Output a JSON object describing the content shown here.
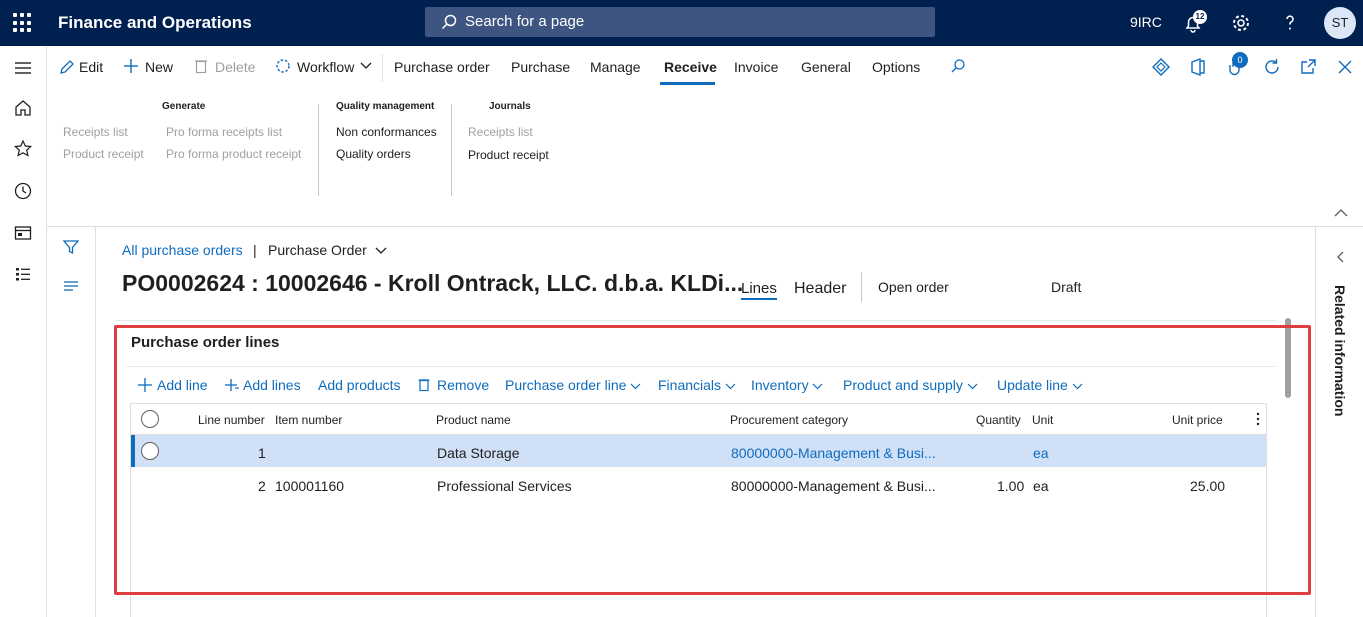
{
  "topbar": {
    "app_title": "Finance and Operations",
    "search_placeholder": "Search for a page",
    "company": "9IRC",
    "notification_count": "12",
    "avatar_initials": "ST"
  },
  "actionpane": {
    "edit": "Edit",
    "new": "New",
    "delete": "Delete",
    "workflow": "Workflow",
    "tabs": [
      "Purchase order",
      "Purchase",
      "Manage",
      "Receive",
      "Invoice",
      "General",
      "Options"
    ],
    "active_tab": "Receive",
    "attachments_count": "0",
    "groups": {
      "generate": {
        "title": "Generate",
        "col1": [
          "Receipts list",
          "Product receipt"
        ],
        "col2": [
          "Pro forma receipts list",
          "Pro forma product receipt"
        ]
      },
      "quality": {
        "title": "Quality management",
        "links": [
          "Non conformances",
          "Quality orders"
        ]
      },
      "journals": {
        "title": "Journals",
        "links": [
          "Receipts list",
          "Product receipt"
        ]
      }
    }
  },
  "page": {
    "breadcrumb_link": "All purchase orders",
    "breadcrumb_sep": "|",
    "breadcrumb_form": "Purchase Order",
    "title": "PO0002624 : 10002646 - Kroll Ontrack, LLC. d.b.a. KLDi...",
    "view_lines": "Lines",
    "view_header": "Header",
    "status_order": "Open order",
    "status_approval": "Draft"
  },
  "lines": {
    "section_title": "Purchase order lines",
    "toolbar": {
      "add_line": "Add line",
      "add_lines": "Add lines",
      "add_products": "Add products",
      "remove": "Remove",
      "purchase_order_line": "Purchase order line",
      "financials": "Financials",
      "inventory": "Inventory",
      "product_and_supply": "Product and supply",
      "update_line": "Update line"
    },
    "columns": [
      "Line number",
      "Item number",
      "Product name",
      "Procurement category",
      "Quantity",
      "Unit",
      "Unit price"
    ],
    "rows": [
      {
        "line_number": "1",
        "item_number": "",
        "product_name": "Data Storage",
        "procurement_category": "80000000-Management & Busi...",
        "quantity": "",
        "unit": "ea",
        "unit_price": ""
      },
      {
        "line_number": "2",
        "item_number": "100001160",
        "product_name": "Professional Services",
        "procurement_category": "80000000-Management & Busi...",
        "quantity": "1.00",
        "unit": "ea",
        "unit_price": "25.00"
      }
    ]
  },
  "related_information": "Related information",
  "colors": {
    "brand": "#002050",
    "accent": "#0f6cbd",
    "highlight": "#e03e3e",
    "selected_row": "#cfe0f7"
  }
}
